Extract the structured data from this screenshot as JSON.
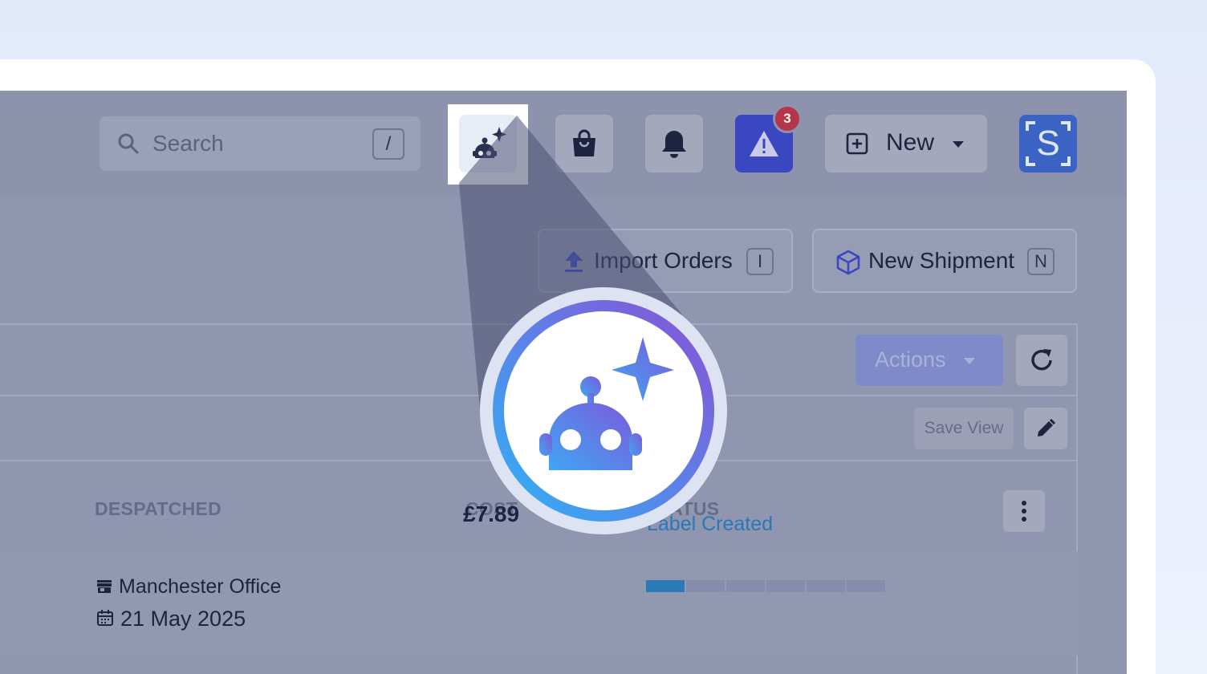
{
  "search": {
    "placeholder": "Search",
    "shortcut": "/"
  },
  "notifications": {
    "alert_count": "3"
  },
  "header": {
    "new_label": "New",
    "avatar_letter": "S"
  },
  "toolbar": {
    "import_label": "Import Orders",
    "import_shortcut": "I",
    "shipment_label": "New Shipment",
    "shipment_shortcut": "N",
    "actions_label": "Actions",
    "save_view_label": "Save View"
  },
  "table": {
    "columns": [
      "DESPATCHED",
      "COST",
      "STATUS"
    ],
    "rows": [
      {
        "location": "Manchester Office",
        "date": "21 May 2025",
        "cost": "£7.89",
        "status": "Label Created",
        "progress_steps": 6,
        "progress_done": 1
      }
    ]
  },
  "colors": {
    "accent": "#3a47c0",
    "status": "#2a78b6",
    "badge": "#b5354a"
  },
  "icons": [
    "search-icon",
    "ai-robot-icon",
    "shopping-bag-icon",
    "bell-icon",
    "warning-icon",
    "plus-square-icon",
    "chevron-down-icon",
    "upload-icon",
    "package-icon",
    "refresh-icon",
    "pencil-icon",
    "store-icon",
    "calendar-icon",
    "more-vertical-icon"
  ]
}
